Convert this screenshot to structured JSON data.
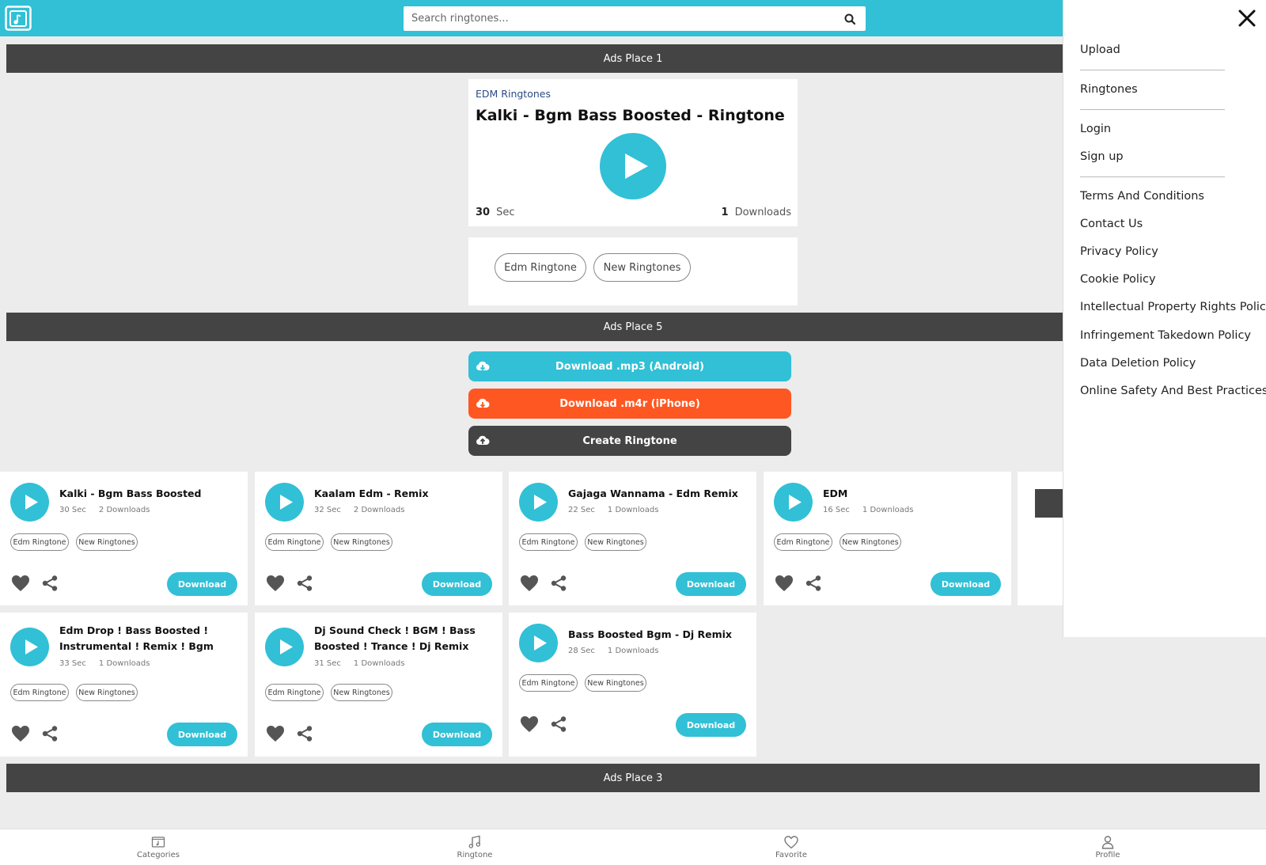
{
  "colors": {
    "accent": "#31c0d6",
    "orange": "#ff5722",
    "dark": "#444444"
  },
  "search": {
    "placeholder": "Search ringtones..."
  },
  "ads": {
    "ad1": "Ads Place 1",
    "ad5": "Ads Place 5",
    "ad3": "Ads Place 3"
  },
  "ringtone": {
    "category": "EDM Ringtones",
    "title": "Kalki - Bgm Bass Boosted - Ringtone",
    "duration": "30",
    "duration_unit": "Sec",
    "downloads": "1",
    "downloads_label": "Downloads",
    "tags": [
      "Edm Ringtone",
      "New Ringtones"
    ]
  },
  "actions": {
    "download_mp3": "Download .mp3 (Android)",
    "download_m4r": "Download .m4r (iPhone)",
    "create": "Create Ringtone"
  },
  "related": [
    {
      "title": "Kalki - Bgm Bass Boosted",
      "sec": "30",
      "downloads": "2",
      "tags": [
        "Edm Ringtone",
        "New Ringtones"
      ],
      "download_label": "Download"
    },
    {
      "title": "Kaalam Edm - Remix",
      "sec": "32",
      "downloads": "2",
      "tags": [
        "Edm Ringtone",
        "New Ringtones"
      ],
      "download_label": "Download"
    },
    {
      "title": "Gajaga Wannama - Edm Remix",
      "sec": "22",
      "downloads": "1",
      "tags": [
        "Edm Ringtone",
        "New Ringtones"
      ],
      "download_label": "Download"
    },
    {
      "title": "EDM",
      "sec": "16",
      "downloads": "1",
      "tags": [
        "Edm Ringtone",
        "New Ringtones"
      ],
      "download_label": "Download"
    },
    {
      "title": "Edm Drop ! Bass Boosted ! Instrumental ! Remix ! Bgm",
      "sec": "33",
      "downloads": "1",
      "tags": [
        "Edm Ringtone",
        "New Ringtones"
      ],
      "download_label": "Download"
    },
    {
      "title": "Dj Sound Check ! BGM ! Bass Boosted ! Trance ! Dj Remix",
      "sec": "31",
      "downloads": "1",
      "tags": [
        "Edm Ringtone",
        "New Ringtones"
      ],
      "download_label": "Download"
    },
    {
      "title": "Bass Boosted Bgm - Dj Remix",
      "sec": "28",
      "downloads": "1",
      "tags": [
        "Edm Ringtone",
        "New Ringtones"
      ],
      "download_label": "Download"
    }
  ],
  "labels": {
    "sec": "Sec",
    "downloads": "Downloads"
  },
  "drawer": {
    "items": [
      "Upload",
      "Ringtones",
      "Login",
      "Sign up",
      "Terms And Conditions",
      "Contact Us",
      "Privacy Policy",
      "Cookie Policy",
      "Intellectual Property Rights Policy",
      "Infringement Takedown Policy",
      "Data Deletion Policy",
      "Online Safety And Best Practices"
    ]
  },
  "bottom_nav": [
    "Categories",
    "Ringtone",
    "Favorite",
    "Profile"
  ]
}
